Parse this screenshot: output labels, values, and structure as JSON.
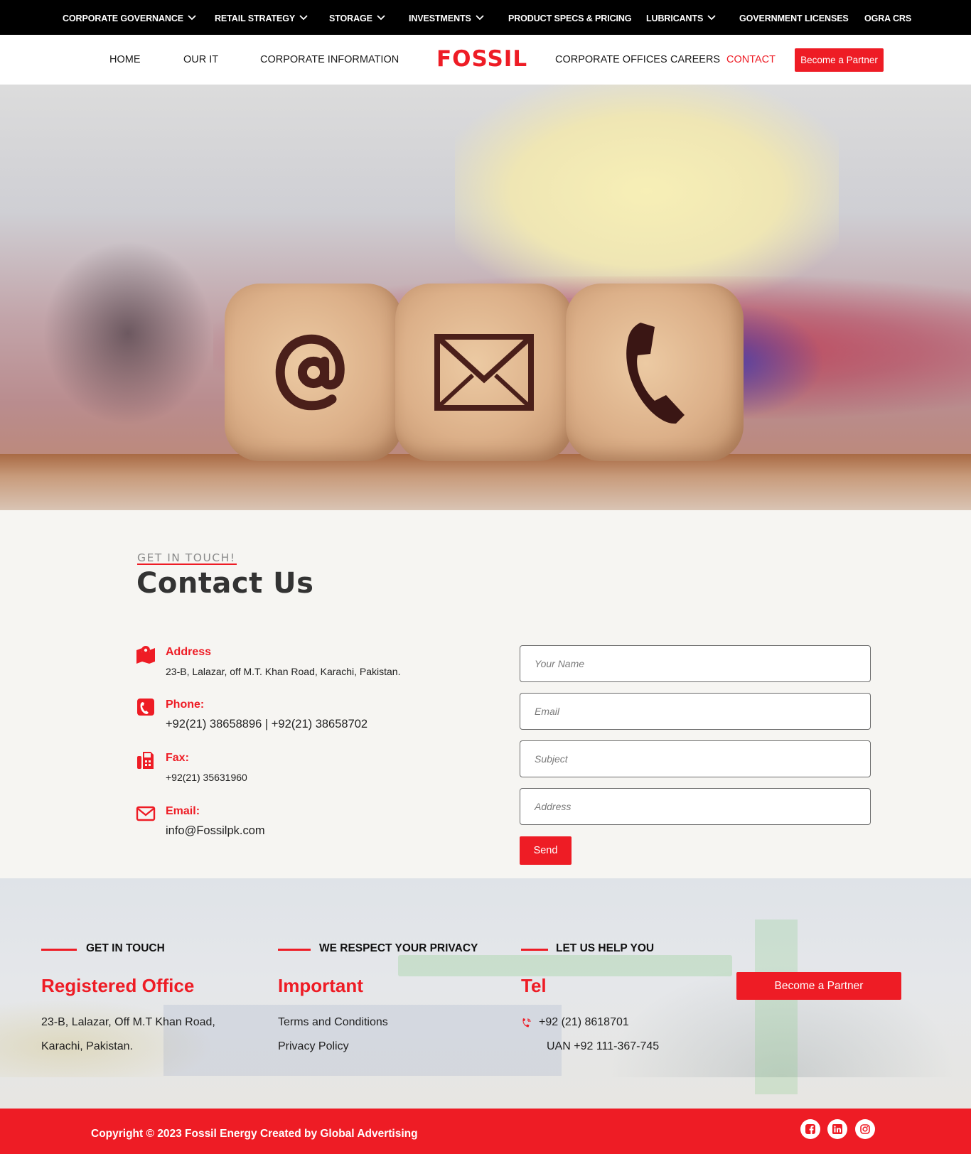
{
  "topbar": {
    "items": [
      {
        "label": "CORPORATE GOVERNANCE",
        "dropdown": true
      },
      {
        "label": "RETAIL STRATEGY",
        "dropdown": true
      },
      {
        "label": "STORAGE",
        "dropdown": true
      },
      {
        "label": "INVESTMENTS",
        "dropdown": true
      },
      {
        "label": "PRODUCT SPECS & PRICING",
        "dropdown": false
      },
      {
        "label": "LUBRICANTS",
        "dropdown": true
      },
      {
        "label": "GOVERNMENT LICENSES",
        "dropdown": false
      },
      {
        "label": "OGRA CRS",
        "dropdown": false
      }
    ]
  },
  "nav": {
    "links": [
      "HOME",
      "OUR IT",
      "CORPORATE INFORMATION",
      "CORPORATE OFFICES",
      "CAREERS",
      "CONTACT"
    ],
    "active": "CONTACT",
    "logo_text": "FOSSIL",
    "partner_button": "Become a Partner"
  },
  "hero": {
    "cube_icons": [
      "at-sign-icon",
      "envelope-icon",
      "phone-icon"
    ]
  },
  "contact": {
    "kicker": "GET IN TOUCH!",
    "title": "Contact Us",
    "info": [
      {
        "icon": "map-marker-icon",
        "label": "Address",
        "value": "23-B, Lalazar, off M.T. Khan Road, Karachi, Pakistan."
      },
      {
        "icon": "phone-square-icon",
        "label": "Phone:",
        "value": "+92(21) 38658896 | +92(21) 38658702"
      },
      {
        "icon": "fax-icon",
        "label": "Fax:",
        "value": "+92(21) 35631960"
      },
      {
        "icon": "envelope-icon",
        "label": "Email:",
        "value": "info@Fossilpk.com"
      }
    ],
    "form": {
      "name_placeholder": "Your Name",
      "email_placeholder": "Email",
      "subject_placeholder": "Subject",
      "address_placeholder": "Address",
      "send_label": "Send"
    }
  },
  "footer": {
    "col1": {
      "kicker": "GET IN TOUCH",
      "heading": "Registered Office",
      "lines": [
        "23-B, Lalazar, Off M.T Khan Road,",
        "Karachi, Pakistan."
      ]
    },
    "col2": {
      "kicker": "WE RESPECT YOUR PRIVACY",
      "heading": "Important",
      "links": [
        "Terms and Conditions",
        "Privacy Policy"
      ]
    },
    "col3": {
      "kicker": "LET US HELP YOU",
      "heading": "Tel",
      "phone": "+92 (21) 8618701",
      "uan": "UAN +92 111-367-745"
    },
    "partner_button": "Become a Partner",
    "copyright": "Copyright © 2023 Fossil Energy Created by Global Advertising",
    "social": [
      "facebook-icon",
      "linkedin-icon",
      "instagram-icon"
    ]
  },
  "colors": {
    "accent": "#ee1c25",
    "topbar": "#000000",
    "section_bg": "#f6f5f2"
  }
}
